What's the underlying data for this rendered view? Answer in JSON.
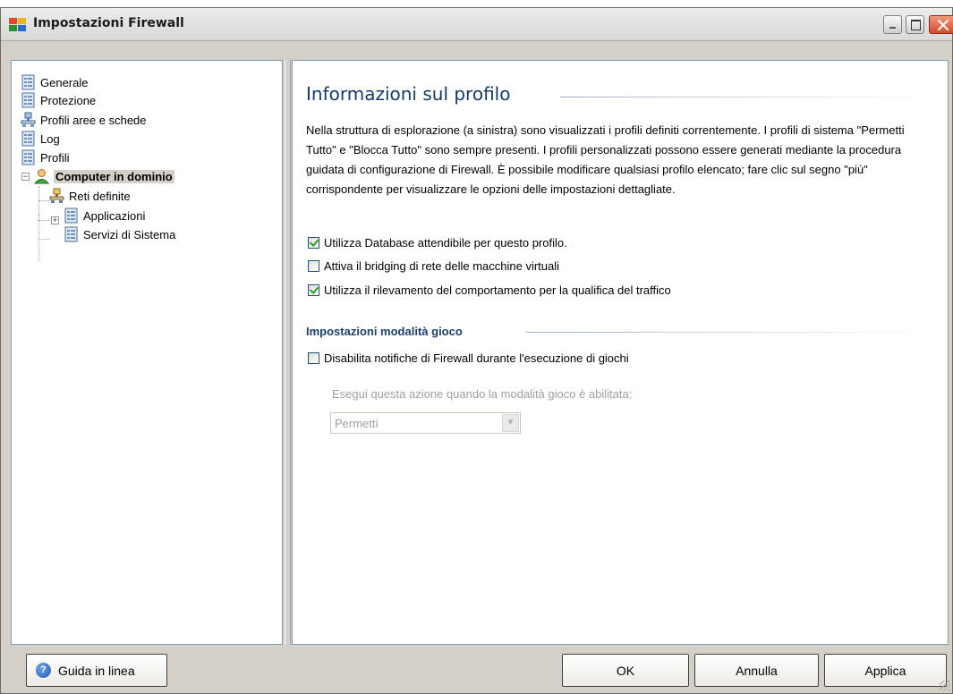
{
  "window": {
    "title": "Impostazioni Firewall"
  },
  "tree": {
    "items": [
      {
        "label": "Generale"
      },
      {
        "label": "Protezione"
      },
      {
        "label": "Profili aree e schede"
      },
      {
        "label": "Log"
      },
      {
        "label": "Profili"
      },
      {
        "label": "Computer in dominio"
      },
      {
        "label": "Reti definite"
      },
      {
        "label": "Applicazioni"
      },
      {
        "label": "Servizi di Sistema"
      }
    ]
  },
  "content": {
    "title": "Informazioni sul profilo",
    "description": "Nella struttura di esplorazione (a sinistra) sono visualizzati i profili definiti correntemente. I profili di sistema \"Permetti Tutto\" e \"Blocca Tutto\" sono sempre presenti. I profili personalizzati possono essere generati mediante la procedura guidata di configurazione di Firewall. È possibile modificare qualsiasi profilo elencato; fare clic sul segno \"più\" corrispondente per visualizzare le opzioni delle impostazioni dettagliate.",
    "checkboxes": [
      {
        "label": "Utilizza Database attendibile per questo profilo.",
        "checked": true
      },
      {
        "label": "Attiva il bridging di rete delle macchine virtuali",
        "checked": false
      },
      {
        "label": "Utilizza il rilevamento del comportamento per la qualifica del traffico",
        "checked": true
      }
    ],
    "game_section": {
      "title": "Impostazioni modalità gioco",
      "checkbox_label": "Disabilita notifiche di Firewall durante l'esecuzione di giochi",
      "checkbox_checked": false,
      "action_label": "Esegui questa azione quando la modalità gioco è abilitata:",
      "action_value": "Permetti"
    }
  },
  "buttons": {
    "help": "Guida in linea",
    "ok": "OK",
    "cancel": "Annulla",
    "apply": "Applica"
  }
}
